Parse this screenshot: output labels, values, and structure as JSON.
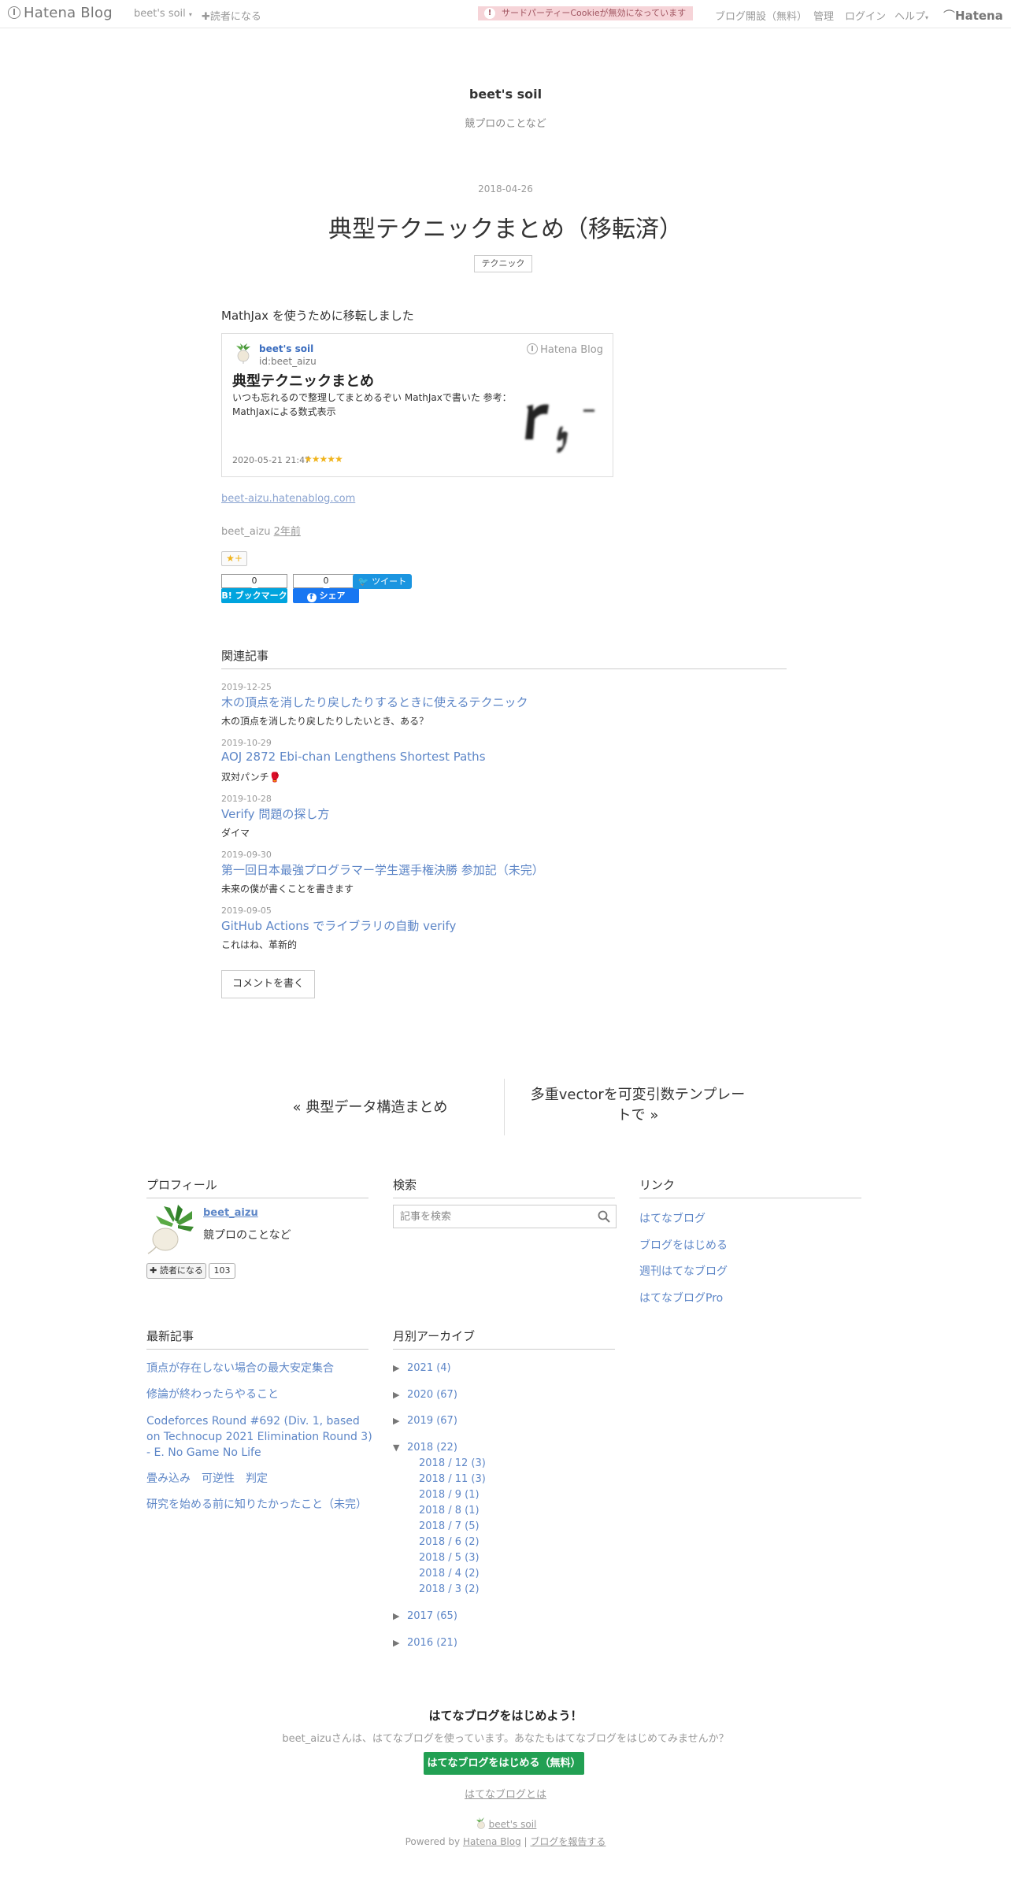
{
  "topbar": {
    "logo": "Hatena Blog",
    "blog_menu": "beet's soil",
    "subscribe": "読者になる",
    "cookie_warning": "サードパーティーCookieが無効になっています",
    "start_blog": "ブログ開設（無料）",
    "admin": "管理",
    "login": "ログイン",
    "help": "ヘルプ",
    "hatena": "Hatena"
  },
  "blog": {
    "title": "beet's soil",
    "description": "競プロのことなど"
  },
  "entry": {
    "date": "2018-04-26",
    "title": "典型テクニックまとめ（移転済）",
    "category": "テクニック",
    "lead": "MathJax を使うために移転しました",
    "embed": {
      "blog_name": "beet's soil",
      "blog_id": "id:beet_aizu",
      "service": "Hatena Blog",
      "title": "典型テクニックまとめ",
      "description": "いつも忘れるので整理してまとめるぞい MathJaxで書いた 参考：MathJaxによる数式表示",
      "date": "2020-05-21 21:47",
      "stars": "★★★★★"
    },
    "embed_link": "beet-aizu.hatenablog.com",
    "author": "beet_aizu",
    "ago": "2年前",
    "star_button": "★+",
    "share": {
      "bookmark_count": "0",
      "bookmark_label": "B! ブックマーク",
      "facebook_count": "0",
      "facebook_label": "シェア",
      "tweet_label": "ツイート"
    }
  },
  "related": {
    "heading": "関連記事",
    "items": [
      {
        "date": "2019-12-25",
        "title": "木の頂点を消したり戻したりするときに使えるテクニック",
        "desc": "木の頂点を消したり戻したりしたいとき、ある？"
      },
      {
        "date": "2019-10-29",
        "title": "AOJ 2872 Ebi-chan Lengthens Shortest Paths",
        "desc": "双対パンチ🥊"
      },
      {
        "date": "2019-10-28",
        "title": "Verify 問題の探し方",
        "desc": "ダイマ"
      },
      {
        "date": "2019-09-30",
        "title": "第一回日本最強プログラマー学生選手権決勝 参加記（未完）",
        "desc": "未来の僕が書くことを書きます"
      },
      {
        "date": "2019-09-05",
        "title": "GitHub Actions でライブラリの自動 verify",
        "desc": "これはね、革新的"
      }
    ],
    "comment_button": "コメントを書く"
  },
  "pager": {
    "prev": "« 典型データ構造まとめ",
    "next": "多重vectorを可変引数テンプレートで »"
  },
  "sidebar": {
    "profile": {
      "heading": "プロフィール",
      "name": "beet_aizu",
      "description": "競プロのことなど",
      "follow": "読者になる",
      "follow_count": "103"
    },
    "search": {
      "heading": "検索",
      "placeholder": "記事を検索"
    },
    "links": {
      "heading": "リンク",
      "items": [
        "はてなブログ",
        "ブログをはじめる",
        "週刊はてなブログ",
        "はてなブログPro"
      ]
    },
    "recent": {
      "heading": "最新記事",
      "items": [
        "頂点が存在しない場合の最大安定集合",
        "修論が終わったらやること",
        "Codeforces Round #692 (Div. 1, based on Technocup 2021 Elimination Round 3) - E. No Game No Life",
        "畳み込み　可逆性　判定",
        "研究を始める前に知りたかったこと（未完）"
      ]
    },
    "archive": {
      "heading": "月別アーカイブ",
      "years": [
        {
          "label": "2021 (4)",
          "toggle": "▶"
        },
        {
          "label": "2020 (67)",
          "toggle": "▶"
        },
        {
          "label": "2019 (67)",
          "toggle": "▶"
        },
        {
          "label": "2018 (22)",
          "toggle": "▼"
        },
        {
          "label": "2017 (65)",
          "toggle": "▶"
        },
        {
          "label": "2016 (21)",
          "toggle": "▶"
        }
      ],
      "months_2018": [
        "2018 / 12 (3)",
        "2018 / 11 (3)",
        "2018 / 9 (1)",
        "2018 / 8 (1)",
        "2018 / 7 (5)",
        "2018 / 6 (2)",
        "2018 / 5 (3)",
        "2018 / 4 (2)",
        "2018 / 3 (2)"
      ]
    }
  },
  "footer": {
    "cta_title": "はてなブログをはじめよう！",
    "cta_desc": "beet_aizuさんは、はてなブログを使っています。あなたもはてなブログをはじめてみませんか？",
    "cta_button": "はてなブログをはじめる（無料）",
    "cta_about": "はてなブログとは",
    "blog_name": "beet's soil",
    "powered_by": "Powered by",
    "hatena_blog": "Hatena Blog",
    "separator": "|",
    "report": "ブログを報告する"
  }
}
